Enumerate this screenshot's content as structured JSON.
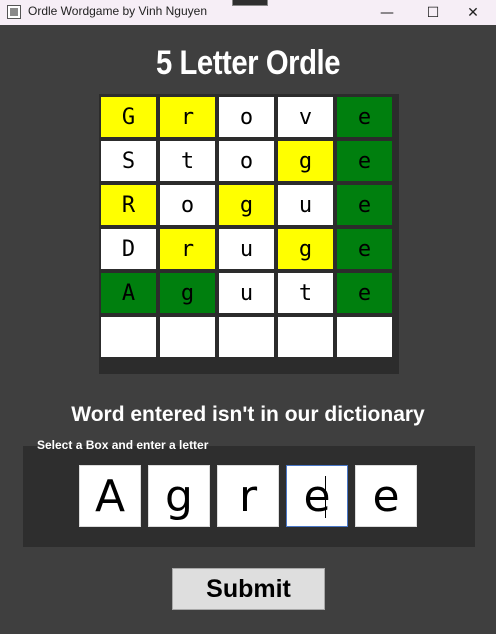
{
  "window": {
    "title": "Ordle Wordgame by Vinh Nguyen",
    "minimize_glyph": "—",
    "maximize_glyph": "☐",
    "close_glyph": "✕"
  },
  "game": {
    "title": "5 Letter Ordle",
    "board": [
      [
        {
          "letter": "G",
          "state": "yellow"
        },
        {
          "letter": "r",
          "state": "yellow"
        },
        {
          "letter": "o",
          "state": "white"
        },
        {
          "letter": "v",
          "state": "white"
        },
        {
          "letter": "e",
          "state": "green"
        }
      ],
      [
        {
          "letter": "S",
          "state": "white"
        },
        {
          "letter": "t",
          "state": "white"
        },
        {
          "letter": "o",
          "state": "white"
        },
        {
          "letter": "g",
          "state": "yellow"
        },
        {
          "letter": "e",
          "state": "green"
        }
      ],
      [
        {
          "letter": "R",
          "state": "yellow"
        },
        {
          "letter": "o",
          "state": "white"
        },
        {
          "letter": "g",
          "state": "yellow"
        },
        {
          "letter": "u",
          "state": "white"
        },
        {
          "letter": "e",
          "state": "green"
        }
      ],
      [
        {
          "letter": "D",
          "state": "white"
        },
        {
          "letter": "r",
          "state": "yellow"
        },
        {
          "letter": "u",
          "state": "white"
        },
        {
          "letter": "g",
          "state": "yellow"
        },
        {
          "letter": "e",
          "state": "green"
        }
      ],
      [
        {
          "letter": "A",
          "state": "green"
        },
        {
          "letter": "g",
          "state": "green"
        },
        {
          "letter": "u",
          "state": "white"
        },
        {
          "letter": "t",
          "state": "white"
        },
        {
          "letter": "e",
          "state": "green"
        }
      ],
      [
        {
          "letter": "",
          "state": "white"
        },
        {
          "letter": "",
          "state": "white"
        },
        {
          "letter": "",
          "state": "white"
        },
        {
          "letter": "",
          "state": "white"
        },
        {
          "letter": "",
          "state": "white"
        }
      ]
    ],
    "colors": {
      "yellow": "#ffff00",
      "green": "#007f0e",
      "white": "#ffffff"
    },
    "message": "Word entered isn't in our dictionary",
    "entry": {
      "caption": "Select a Box and enter a letter",
      "letters": [
        "A",
        "g",
        "r",
        "e",
        "e"
      ],
      "focused_index": 3
    },
    "submit_label": "Submit"
  }
}
